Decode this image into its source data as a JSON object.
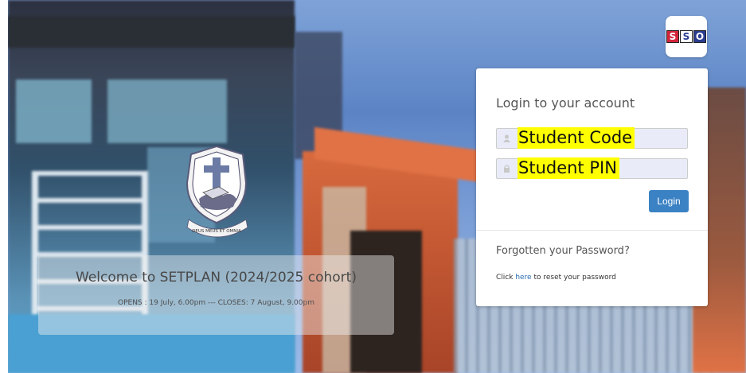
{
  "brand": {
    "logo_letters": [
      "S",
      "S",
      "O"
    ],
    "colors": {
      "red": "#d3253a",
      "navy": "#2a3c8f"
    }
  },
  "crest": {
    "motto": "DEUS MEUS ET OMNIA"
  },
  "welcome": {
    "title": "Welcome to SETPLAN (2024/2025 cohort)",
    "subtitle": "OPENS : 19 July, 6.00pm --- CLOSES: 7 August, 9.00pm"
  },
  "login": {
    "heading": "Login to your account",
    "code_field": {
      "icon": "user-icon",
      "highlight_text": "Student Code",
      "placeholder": ""
    },
    "pin_field": {
      "icon": "lock-icon",
      "highlight_text": "Student PIN",
      "placeholder": ""
    },
    "button_label": "Login",
    "accent_color": "#3b82c4"
  },
  "forgot": {
    "heading": "Forgotten your Password?",
    "reset_prefix": "Click ",
    "reset_link": "here",
    "reset_suffix": " to reset your password"
  }
}
